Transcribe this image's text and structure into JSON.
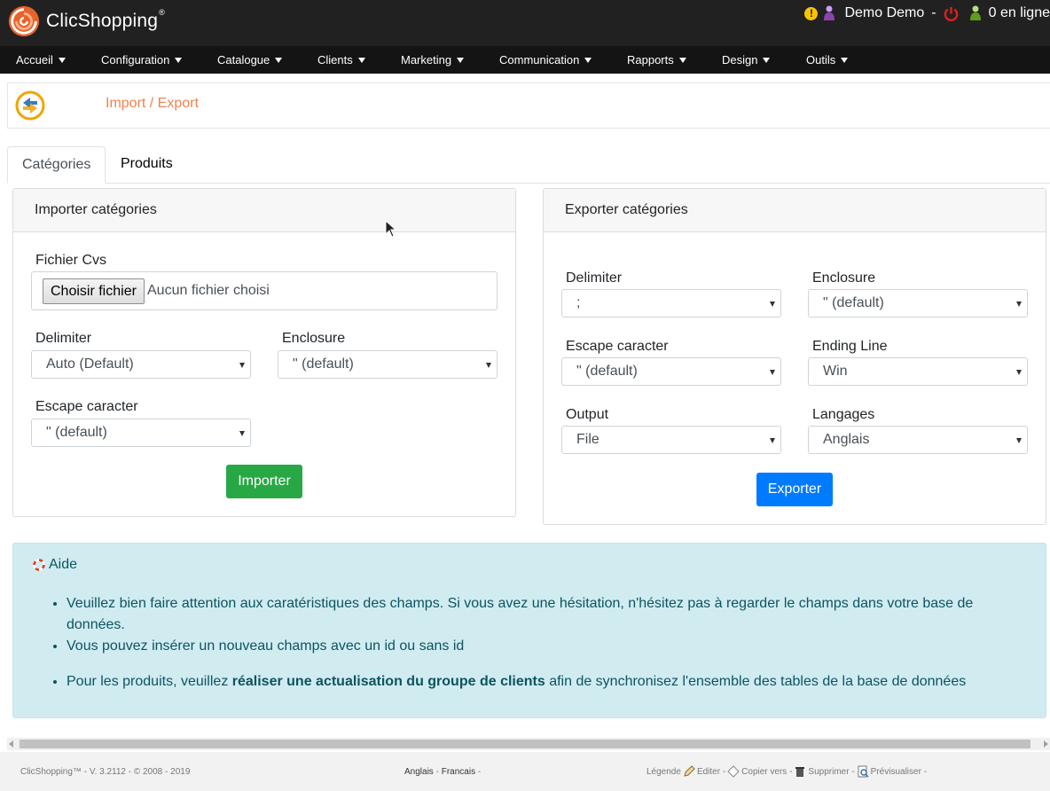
{
  "header": {
    "logo_text": "ClicShopping",
    "logo_mark": "®",
    "warn_icon": "!",
    "user": "Demo Demo",
    "user_sep": "-",
    "online": "0 en ligne",
    "colors": {
      "bg": "#212121",
      "accent": "#f0824f"
    }
  },
  "nav": {
    "items": [
      {
        "label": "Accueil"
      },
      {
        "label": "Configuration"
      },
      {
        "label": "Catalogue"
      },
      {
        "label": "Clients"
      },
      {
        "label": "Marketing"
      },
      {
        "label": "Communication"
      },
      {
        "label": "Rapports"
      },
      {
        "label": "Design"
      },
      {
        "label": "Outils"
      }
    ]
  },
  "page": {
    "title": "Import / Export"
  },
  "tabs": [
    {
      "label": "Catégories",
      "active": true
    },
    {
      "label": "Produits",
      "active": false
    }
  ],
  "import": {
    "title": "Importer catégories",
    "file_label": "Fichier Cvs",
    "file_button": "Choisir fichier",
    "file_status": "Aucun fichier choisi",
    "delimiter_label": "Delimiter",
    "delimiter_value": "Auto (Default)",
    "enclosure_label": "Enclosure",
    "enclosure_value": "\" (default)",
    "escape_label": "Escape caracter",
    "escape_value": "\" (default)",
    "button": "Importer"
  },
  "export": {
    "title": "Exporter catégories",
    "delimiter_label": "Delimiter",
    "delimiter_value": ";",
    "enclosure_label": "Enclosure",
    "enclosure_value": "\" (default)",
    "escape_label": "Escape caracter",
    "escape_value": "\" (default)",
    "ending_label": "Ending Line",
    "ending_value": "Win",
    "output_label": "Output",
    "output_value": "File",
    "lang_label": "Langages",
    "lang_value": "Anglais",
    "button": "Exporter"
  },
  "help": {
    "title": "Aide",
    "item1": "Veuillez bien faire attention aux caratéristiques des champs. Si vous avez une hésitation, n'hésitez pas à regarder le champs dans votre base de données.",
    "item2": "Vous pouvez insérer un nouveau champs avec un id ou sans id",
    "item3_pre": "Pour les produits, veuillez ",
    "item3_bold": "réaliser une actualisation du groupe de clients",
    "item3_post": " afin de synchronisez l'ensemble des tables de la base de données"
  },
  "footer": {
    "copyright": "ClicShopping™ - V. 3.2112 - © 2008 - 2019",
    "lang_en": "Anglais",
    "lang_fr": "Francais",
    "sep": "-",
    "legend": "Légende",
    "edit": "Editer -",
    "copy": "Copier vers -",
    "delete": "Supprimer -",
    "preview": "Prévisualiser -"
  }
}
